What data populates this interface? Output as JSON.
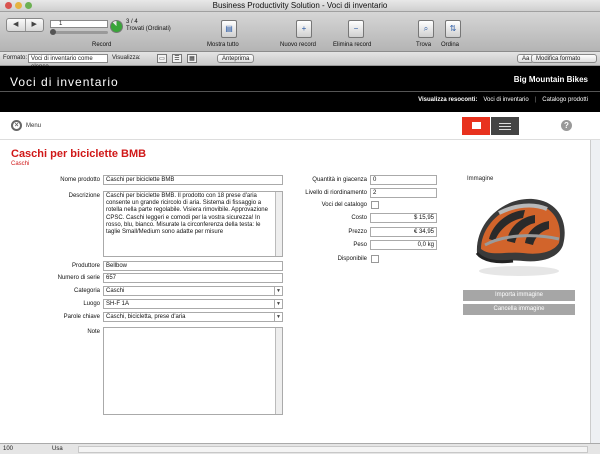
{
  "window": {
    "title": "Business Productivity Solution - Voci di inventario"
  },
  "toolbar": {
    "record_number": "1",
    "record_total": "3 / 4",
    "record_found": "Trovati (Ordinati)",
    "records_label": "Record",
    "show_all_label": "Mostra tutto",
    "new_record_label": "Nuovo record",
    "delete_record_label": "Elimina record",
    "find_label": "Trova",
    "sort_label": "Ordina"
  },
  "layoutbar": {
    "layout_label": "Formato:",
    "layout_value": "Voci di inventario come elenco",
    "view_label": "Visualizza:",
    "preview_label": "Anteprima",
    "aa_label": "Aa",
    "toolbar_btn": "Modifica formato"
  },
  "header": {
    "title": "Voci di inventario",
    "brand": "Big Mountain Bikes",
    "nav_label": "Visualizza resoconti:",
    "nav_items": [
      "Voci di inventario",
      "Catalogo prodotti"
    ]
  },
  "subbar": {
    "menu_label": "Menu"
  },
  "record": {
    "title": "Caschi per biciclette BMB",
    "category_line": "Caschi"
  },
  "fields": {
    "nome_label": "Nome prodotto",
    "nome_value": "Caschi per biciclette BMB",
    "desc_label": "Descrizione",
    "desc_value": "Caschi per biciclette BMB. Il prodotto con 18 prese d'aria consente un grande ricircolo di aria. Sistema di fissaggio a rotella nella parte regolabile. Visiera rimovibile. Approvazione CPSC. Caschi leggeri e comodi per la vostra sicurezza! In rosso, blu, bianco. Misurate la circonferenza della testa: le taglie Small/Medium sono adatte per misure",
    "fornitore_label": "Produttore",
    "fornitore_value": "Bellbow",
    "numero_label": "Numero di serie",
    "numero_value": "657",
    "categoria_label": "Categoria",
    "categoria_value": "Caschi",
    "luogo_label": "Luogo",
    "luogo_value": "SH-F 1A",
    "parole_label": "Parole chiave",
    "parole_value": "Caschi, bicicletta, prese d'aria",
    "note_label": "Note",
    "note_value": "",
    "qta_label": "Quantità in giacenza",
    "qta_value": "0",
    "livello_label": "Livello di riordinamento",
    "livello_value": "2",
    "voci_label": "Voci del catalogo",
    "costo_label": "Costo",
    "costo_value": "$ 15,95",
    "prezzo_label": "Prezzo",
    "prezzo_value": "€ 34,95",
    "peso_label": "Peso",
    "peso_value": "0,0 kg",
    "disponibile_label": "Disponibile"
  },
  "image": {
    "label": "Immagine",
    "import_btn": "Importa immagine",
    "delete_btn": "Cancella immagine"
  },
  "statusbar": {
    "zoom": "100",
    "mode": "Usa"
  }
}
